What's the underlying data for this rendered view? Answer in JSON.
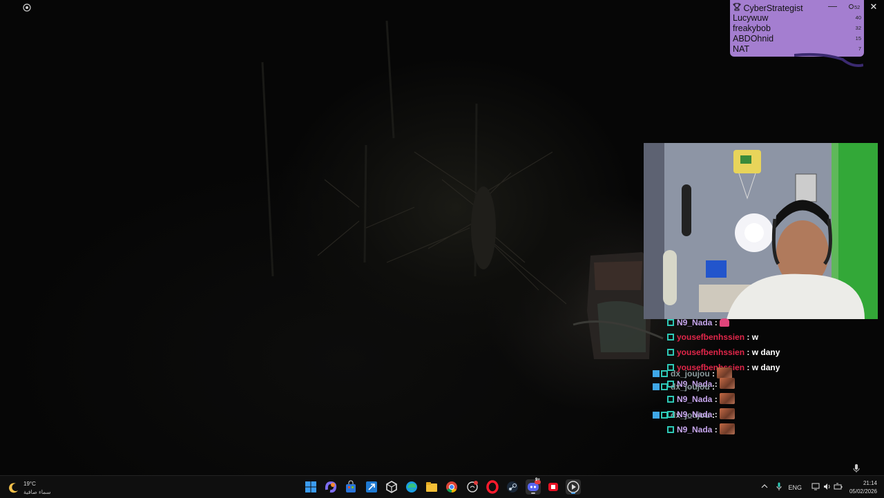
{
  "leaderboard": {
    "title": "CyberStrategist",
    "viewer_count": "52",
    "minimize_glyph": "—",
    "close_glyph": "✕",
    "entries": [
      {
        "name": "Lucywuw",
        "score": "40"
      },
      {
        "name": "freakybob",
        "score": "32"
      },
      {
        "name": "ABDOhnid",
        "score": "15"
      },
      {
        "name": "NAT",
        "score": "7"
      }
    ],
    "bg_color": "#a47ed0"
  },
  "chat": {
    "lines": [
      {
        "user": "N9_Nada",
        "sep": " :",
        "msg": "",
        "emote": "pink"
      },
      {
        "user": "yousefbenhssien",
        "sep": " :",
        "msg": " w",
        "emote": ""
      },
      {
        "user": "yousefbenhssien",
        "sep": " :",
        "msg": " w dany",
        "emote": ""
      },
      {
        "user": "yousefbenhssien",
        "sep": " :",
        "msg": " w dany",
        "emote": ""
      },
      {
        "user": "dx_joujou",
        "sep": " :",
        "msg": "",
        "emote": "brown"
      },
      {
        "user": "N9_Nada",
        "sep": " :",
        "msg": "",
        "emote": "brown"
      },
      {
        "user": "dx_joujou",
        "sep": " :",
        "msg": "",
        "emote": ""
      },
      {
        "user": "N9_Nada",
        "sep": " :",
        "msg": "",
        "emote": "brown"
      },
      {
        "user": "dx_joujou",
        "sep": " :",
        "msg": "",
        "emote": ""
      },
      {
        "user": "N9_Nada",
        "sep": " :",
        "msg": "",
        "emote": "brown"
      },
      {
        "user": "N9_Nada",
        "sep": " :",
        "msg": "",
        "emote": "brown"
      }
    ],
    "colors": {
      "red": "#e2264a",
      "lavender": "#c7a6ee",
      "grey": "#8a9a9c",
      "badge": "#2ec9b7"
    }
  },
  "taskbar": {
    "weather": {
      "temp": "19°C",
      "desc": "سماء صافية"
    },
    "apps": [
      {
        "name": "start"
      },
      {
        "name": "copilot"
      },
      {
        "name": "store"
      },
      {
        "name": "visual-studio"
      },
      {
        "name": "unity"
      },
      {
        "name": "edge"
      },
      {
        "name": "file-explorer"
      },
      {
        "name": "chrome"
      },
      {
        "name": "dolphin"
      },
      {
        "name": "opera"
      },
      {
        "name": "steam"
      },
      {
        "name": "discord"
      },
      {
        "name": "recorder"
      },
      {
        "name": "media-player"
      }
    ],
    "discord_badge": "9+",
    "tray": {
      "language": "ENG"
    },
    "clock": {
      "time": "21:14",
      "date": "05/02/2026"
    }
  }
}
